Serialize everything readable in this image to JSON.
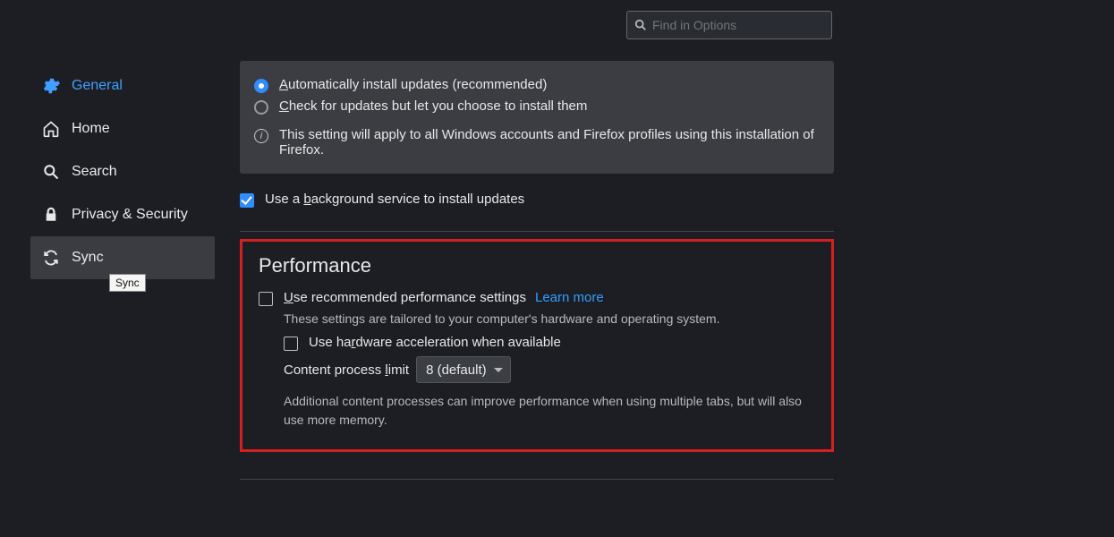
{
  "search": {
    "placeholder": "Find in Options"
  },
  "sidebar": {
    "items": [
      {
        "label": "General"
      },
      {
        "label": "Home"
      },
      {
        "label": "Search"
      },
      {
        "label": "Privacy & Security"
      },
      {
        "label": "Sync"
      }
    ],
    "tooltip": "Sync"
  },
  "updates": {
    "radio1_pre": "A",
    "radio1_rest": "utomatically install updates (recommended)",
    "radio2_pre": "C",
    "radio2_rest": "heck for updates but let you choose to install them",
    "info": "This setting will apply to all Windows accounts and Firefox profiles using this installation of Firefox.",
    "bg_pre": "Use a ",
    "bg_u": "b",
    "bg_rest": "ackground service to install updates"
  },
  "performance": {
    "heading": "Performance",
    "rec_u": "U",
    "rec_rest": "se recommended performance settings",
    "learn_more": "Learn more",
    "tailored": "These settings are tailored to your computer's hardware and operating system.",
    "hw_pre": "Use ha",
    "hw_u": "r",
    "hw_rest": "dware acceleration when available",
    "cpl_pre": "Content process ",
    "cpl_u": "l",
    "cpl_rest": "imit",
    "cpl_value": "8 (default)",
    "note": "Additional content processes can improve performance when using multiple tabs, but will also use more memory."
  }
}
